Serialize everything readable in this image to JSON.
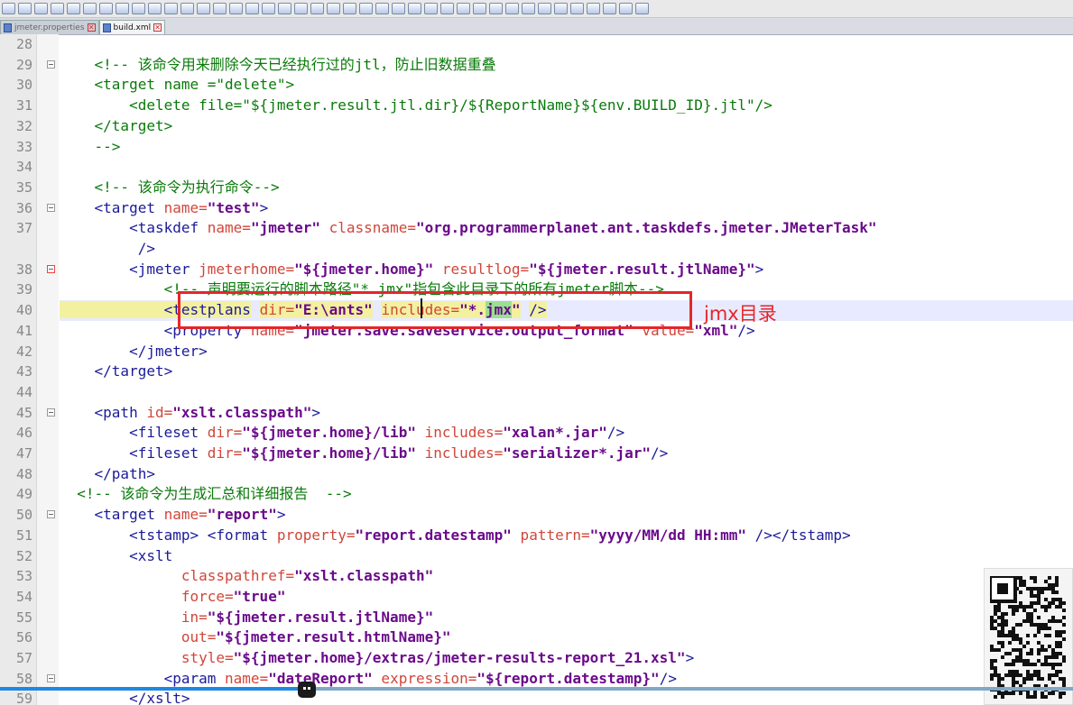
{
  "tabs": [
    {
      "label": "jmeter.properties",
      "active": false
    },
    {
      "label": "build.xml",
      "active": true
    }
  ],
  "annotation": "jmx目录",
  "video_progress": 0.28,
  "lines": [
    {
      "num": "28",
      "fold": false,
      "segs": []
    },
    {
      "num": "29",
      "fold": true,
      "segs": [
        {
          "t": "    <!-- 该命令用来删除今天已经执行过的jtl，防止旧数据重叠",
          "c": "c"
        }
      ]
    },
    {
      "num": "30",
      "fold": false,
      "segs": [
        {
          "t": "    <target name =\"delete\">",
          "c": "c"
        }
      ]
    },
    {
      "num": "31",
      "fold": false,
      "segs": [
        {
          "t": "        <delete file=\"${jmeter.result.jtl.dir}/${ReportName}${env.BUILD_ID}.jtl\"/>",
          "c": "c"
        }
      ]
    },
    {
      "num": "32",
      "fold": false,
      "segs": [
        {
          "t": "    </target>",
          "c": "c"
        }
      ]
    },
    {
      "num": "33",
      "fold": false,
      "segs": [
        {
          "t": "    -->",
          "c": "c"
        }
      ]
    },
    {
      "num": "34",
      "fold": false,
      "segs": []
    },
    {
      "num": "35",
      "fold": false,
      "segs": [
        {
          "t": "    <!-- 该命令为执行命令-->",
          "c": "c"
        }
      ]
    },
    {
      "num": "36",
      "fold": true,
      "segs": [
        {
          "t": "    <target ",
          "c": "t"
        },
        {
          "t": "name=",
          "c": "a"
        },
        {
          "t": "\"test\"",
          "c": "v"
        },
        {
          "t": ">",
          "c": "t"
        }
      ]
    },
    {
      "num": "37",
      "fold": false,
      "segs": [
        {
          "t": "        <taskdef ",
          "c": "t"
        },
        {
          "t": "name=",
          "c": "a"
        },
        {
          "t": "\"jmeter\"",
          "c": "v"
        },
        {
          "t": " classname=",
          "c": "a"
        },
        {
          "t": "\"org.programmerplanet.ant.taskdefs.jmeter.JMeterTask\"",
          "c": "v"
        }
      ]
    },
    {
      "num": "",
      "fold": false,
      "segs": [
        {
          "t": "         />",
          "c": "t"
        }
      ]
    },
    {
      "num": "38",
      "fold": true,
      "red": true,
      "segs": [
        {
          "t": "        <jmeter ",
          "c": "t"
        },
        {
          "t": "jmeterhome=",
          "c": "a"
        },
        {
          "t": "\"${jmeter.home}\"",
          "c": "v"
        },
        {
          "t": " resultlog=",
          "c": "a"
        },
        {
          "t": "\"${jmeter.result.jtlName}\"",
          "c": "v"
        },
        {
          "t": ">",
          "c": "t"
        }
      ]
    },
    {
      "num": "39",
      "fold": false,
      "segs": [
        {
          "t": "            <!-- 声明要运行的脚本路径\"*.jmx\"指包含此目录下的所有jmeter脚本-->",
          "c": "c"
        }
      ]
    },
    {
      "num": "40",
      "fold": false,
      "current": true,
      "segs": [
        {
          "t": "            <testplans",
          "c": "t",
          "h": "hl"
        },
        {
          "t": " ",
          "c": "t"
        },
        {
          "t": "dir=",
          "c": "a",
          "h": "hl"
        },
        {
          "t": "\"E:\\ants\"",
          "c": "v",
          "h": "hl"
        },
        {
          "t": " ",
          "c": "t"
        },
        {
          "t": "includes=",
          "c": "a",
          "h": "hl"
        },
        {
          "t": "\"*.",
          "c": "v",
          "h": "hl"
        },
        {
          "t": "jmx",
          "c": "v",
          "h": "hlg"
        },
        {
          "t": "\"",
          "c": "v",
          "h": "hl"
        },
        {
          "t": " ",
          "c": "t"
        },
        {
          "t": "/>",
          "c": "t",
          "h": "hl"
        }
      ]
    },
    {
      "num": "41",
      "fold": false,
      "segs": [
        {
          "t": "            <property ",
          "c": "t"
        },
        {
          "t": "name=",
          "c": "a"
        },
        {
          "t": "\"jmeter.save.saveservice.output_format\"",
          "c": "v"
        },
        {
          "t": " value=",
          "c": "a"
        },
        {
          "t": "\"xml\"",
          "c": "v"
        },
        {
          "t": "/>",
          "c": "t"
        }
      ]
    },
    {
      "num": "42",
      "fold": false,
      "segs": [
        {
          "t": "        </jmeter>",
          "c": "t"
        }
      ]
    },
    {
      "num": "43",
      "fold": false,
      "segs": [
        {
          "t": "    </target>",
          "c": "t"
        }
      ]
    },
    {
      "num": "44",
      "fold": false,
      "segs": []
    },
    {
      "num": "45",
      "fold": true,
      "segs": [
        {
          "t": "    <path ",
          "c": "t"
        },
        {
          "t": "id=",
          "c": "a"
        },
        {
          "t": "\"xslt.classpath\"",
          "c": "v"
        },
        {
          "t": ">",
          "c": "t"
        }
      ]
    },
    {
      "num": "46",
      "fold": false,
      "segs": [
        {
          "t": "        <fileset ",
          "c": "t"
        },
        {
          "t": "dir=",
          "c": "a"
        },
        {
          "t": "\"${jmeter.home}/lib\"",
          "c": "v"
        },
        {
          "t": " includes=",
          "c": "a"
        },
        {
          "t": "\"xalan*.jar\"",
          "c": "v"
        },
        {
          "t": "/>",
          "c": "t"
        }
      ]
    },
    {
      "num": "47",
      "fold": false,
      "segs": [
        {
          "t": "        <fileset ",
          "c": "t"
        },
        {
          "t": "dir=",
          "c": "a"
        },
        {
          "t": "\"${jmeter.home}/lib\"",
          "c": "v"
        },
        {
          "t": " includes=",
          "c": "a"
        },
        {
          "t": "\"serializer*.jar\"",
          "c": "v"
        },
        {
          "t": "/>",
          "c": "t"
        }
      ]
    },
    {
      "num": "48",
      "fold": false,
      "segs": [
        {
          "t": "    </path>",
          "c": "t"
        }
      ]
    },
    {
      "num": "49",
      "fold": false,
      "segs": [
        {
          "t": "  <!-- 该命令为生成汇总和详细报告  -->",
          "c": "c"
        }
      ]
    },
    {
      "num": "50",
      "fold": true,
      "segs": [
        {
          "t": "    <target ",
          "c": "t"
        },
        {
          "t": "name=",
          "c": "a"
        },
        {
          "t": "\"report\"",
          "c": "v"
        },
        {
          "t": ">",
          "c": "t"
        }
      ]
    },
    {
      "num": "51",
      "fold": false,
      "segs": [
        {
          "t": "        <tstamp> <format ",
          "c": "t"
        },
        {
          "t": "property=",
          "c": "a"
        },
        {
          "t": "\"report.datestamp\"",
          "c": "v"
        },
        {
          "t": " pattern=",
          "c": "a"
        },
        {
          "t": "\"yyyy/MM/dd HH:mm\"",
          "c": "v"
        },
        {
          "t": " /></tstamp>",
          "c": "t"
        }
      ]
    },
    {
      "num": "52",
      "fold": false,
      "segs": [
        {
          "t": "        <xslt",
          "c": "t"
        }
      ]
    },
    {
      "num": "53",
      "fold": false,
      "segs": [
        {
          "t": "              classpathref=",
          "c": "a"
        },
        {
          "t": "\"xslt.classpath\"",
          "c": "v"
        }
      ]
    },
    {
      "num": "54",
      "fold": false,
      "segs": [
        {
          "t": "              force=",
          "c": "a"
        },
        {
          "t": "\"true\"",
          "c": "v"
        }
      ]
    },
    {
      "num": "55",
      "fold": false,
      "segs": [
        {
          "t": "              in=",
          "c": "a"
        },
        {
          "t": "\"${jmeter.result.jtlName}\"",
          "c": "v"
        }
      ]
    },
    {
      "num": "56",
      "fold": false,
      "segs": [
        {
          "t": "              out=",
          "c": "a"
        },
        {
          "t": "\"${jmeter.result.htmlName}\"",
          "c": "v"
        }
      ]
    },
    {
      "num": "57",
      "fold": false,
      "segs": [
        {
          "t": "              style=",
          "c": "a"
        },
        {
          "t": "\"${jmeter.home}/extras/jmeter-results-report_21.xsl\"",
          "c": "v"
        },
        {
          "t": ">",
          "c": "t"
        }
      ]
    },
    {
      "num": "58",
      "fold": true,
      "segs": [
        {
          "t": "            <param ",
          "c": "t"
        },
        {
          "t": "name=",
          "c": "a"
        },
        {
          "t": "\"dateReport\"",
          "c": "v"
        },
        {
          "t": " expression=",
          "c": "a"
        },
        {
          "t": "\"${report.datestamp}\"",
          "c": "v"
        },
        {
          "t": "/>",
          "c": "t"
        }
      ]
    },
    {
      "num": "59",
      "fold": false,
      "segs": [
        {
          "t": "        </xslt>",
          "c": "t"
        }
      ]
    }
  ]
}
